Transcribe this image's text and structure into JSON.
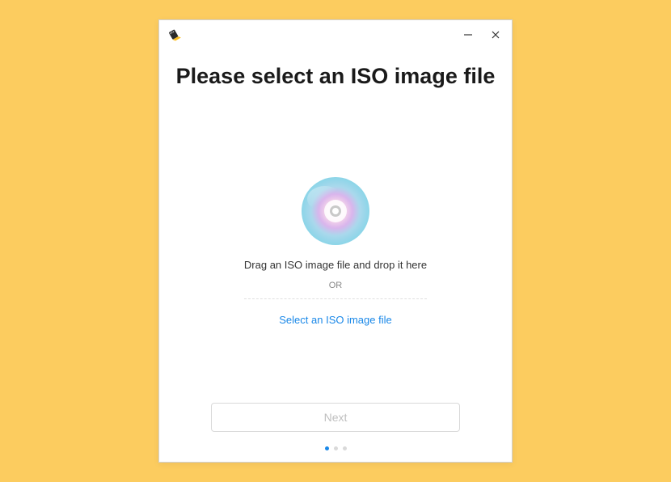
{
  "heading": "Please select an ISO image file",
  "dropzone": {
    "drag_text": "Drag an ISO image file and drop it here",
    "or_text": "OR",
    "select_link": "Select an ISO image file"
  },
  "footer": {
    "next_label": "Next",
    "step_count": 3,
    "active_step": 0
  },
  "colors": {
    "accent": "#1a88e8",
    "background": "#fccc5f"
  }
}
